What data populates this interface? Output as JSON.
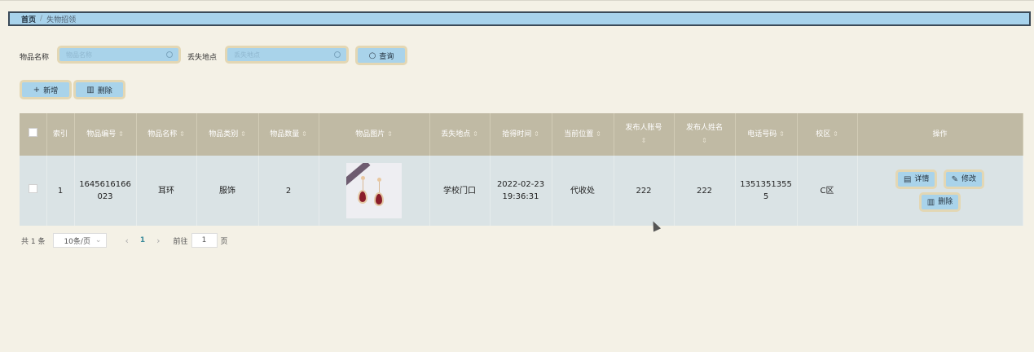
{
  "breadcrumb": {
    "home": "首页",
    "separator": "/",
    "current": "失物招领"
  },
  "search": {
    "name_label": "物品名称",
    "name_placeholder": "物品名称",
    "place_label": "丢失地点",
    "place_placeholder": "丢失地点",
    "query_label": "查询"
  },
  "toolbar": {
    "add_label": "新增",
    "delete_label": "删除"
  },
  "table": {
    "headers": [
      "索引",
      "物品编号",
      "物品名称",
      "物品类别",
      "物品数量",
      "物品图片",
      "丢失地点",
      "拾得时间",
      "当前位置",
      "发布人账号",
      "发布人姓名",
      "电话号码",
      "校区",
      "操作"
    ],
    "rows": [
      {
        "index": "1",
        "item_no": "1645616166023",
        "item_name": "耳环",
        "category": "服饰",
        "quantity": "2",
        "image": "earring-photo",
        "place": "学校门口",
        "time": "2022-02-23 19:36:31",
        "location": "代收处",
        "publisher_account": "222",
        "publisher_name": "222",
        "phone": "13513513555",
        "campus": "C区",
        "actions": {
          "detail": "详情",
          "edit": "修改",
          "delete": "删除"
        }
      }
    ]
  },
  "pagination": {
    "total": "共 1 条",
    "page_size": "10条/页",
    "current_page": "1",
    "goto_label": "前往",
    "goto_value": "1",
    "page_unit": "页"
  },
  "colors": {
    "accent": "#a9d3ea",
    "header_bg": "#c0baa4",
    "row_bg": "#dae3e5",
    "page_bg": "#f4f1e6"
  }
}
